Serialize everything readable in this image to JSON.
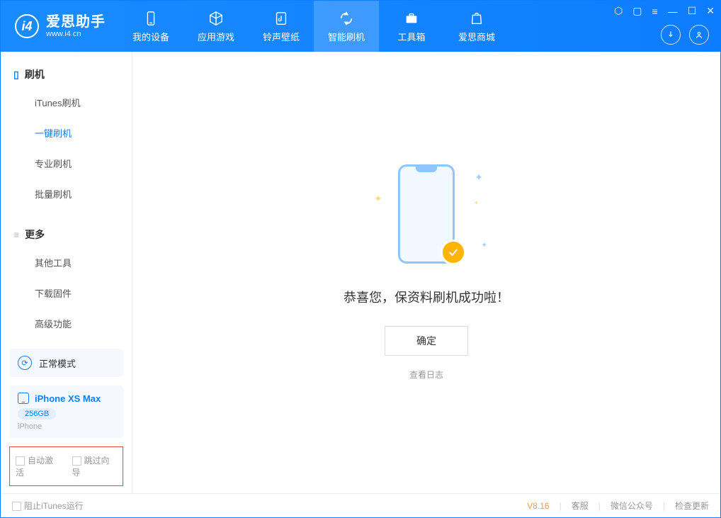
{
  "app": {
    "title": "爱思助手",
    "subtitle": "www.i4.cn"
  },
  "nav": {
    "items": [
      {
        "label": "我的设备"
      },
      {
        "label": "应用游戏"
      },
      {
        "label": "铃声壁纸"
      },
      {
        "label": "智能刷机"
      },
      {
        "label": "工具箱"
      },
      {
        "label": "爱思商城"
      }
    ]
  },
  "sidebar": {
    "section_flash": "刷机",
    "section_more": "更多",
    "flash_items": [
      "iTunes刷机",
      "一键刷机",
      "专业刷机",
      "批量刷机"
    ],
    "more_items": [
      "其他工具",
      "下载固件",
      "高级功能"
    ],
    "mode_label": "正常模式",
    "device_name": "iPhone XS Max",
    "device_storage": "256GB",
    "device_type": "iPhone",
    "checkbox_auto": "自动激活",
    "checkbox_skip": "跳过向导"
  },
  "main": {
    "success_msg": "恭喜您，保资料刷机成功啦！",
    "ok_label": "确定",
    "log_link": "查看日志"
  },
  "status": {
    "block_itunes": "阻止iTunes运行",
    "version": "V8.16",
    "support": "客服",
    "wechat": "微信公众号",
    "update": "检查更新"
  }
}
